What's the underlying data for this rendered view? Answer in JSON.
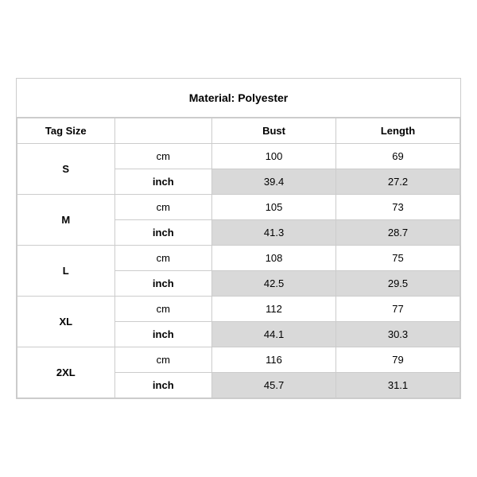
{
  "title": "Material: Polyester",
  "headers": {
    "tag_size": "Tag Size",
    "bust": "Bust",
    "length": "Length"
  },
  "sizes": [
    {
      "tag": "S",
      "cm_bust": "100",
      "cm_length": "69",
      "inch_bust": "39.4",
      "inch_length": "27.2"
    },
    {
      "tag": "M",
      "cm_bust": "105",
      "cm_length": "73",
      "inch_bust": "41.3",
      "inch_length": "28.7"
    },
    {
      "tag": "L",
      "cm_bust": "108",
      "cm_length": "75",
      "inch_bust": "42.5",
      "inch_length": "29.5"
    },
    {
      "tag": "XL",
      "cm_bust": "112",
      "cm_length": "77",
      "inch_bust": "44.1",
      "inch_length": "30.3"
    },
    {
      "tag": "2XL",
      "cm_bust": "116",
      "cm_length": "79",
      "inch_bust": "45.7",
      "inch_length": "31.1"
    }
  ],
  "unit_cm": "cm",
  "unit_inch": "inch"
}
